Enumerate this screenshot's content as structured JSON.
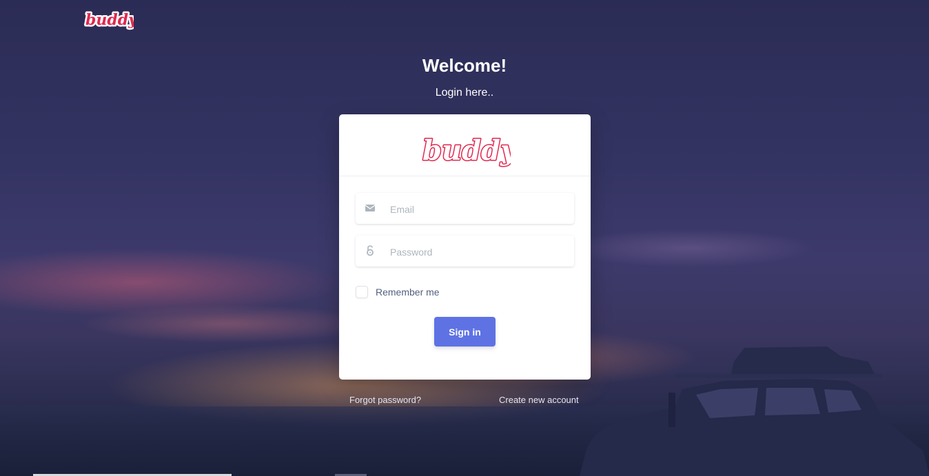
{
  "brand": {
    "logo_text": "buddy",
    "logo_color": "#e0274f"
  },
  "hero": {
    "title": "Welcome!",
    "subtitle": "Login here.."
  },
  "login_form": {
    "email_placeholder": "Email",
    "password_placeholder": "Password",
    "remember_label": "Remember me",
    "remember_checked": false,
    "submit_label": "Sign in",
    "submit_color": "#5e72e4"
  },
  "links": {
    "forgot_password": "Forgot password?",
    "create_account": "Create new account"
  },
  "icons": {
    "email": "envelope-icon",
    "password": "lock-open-icon"
  }
}
